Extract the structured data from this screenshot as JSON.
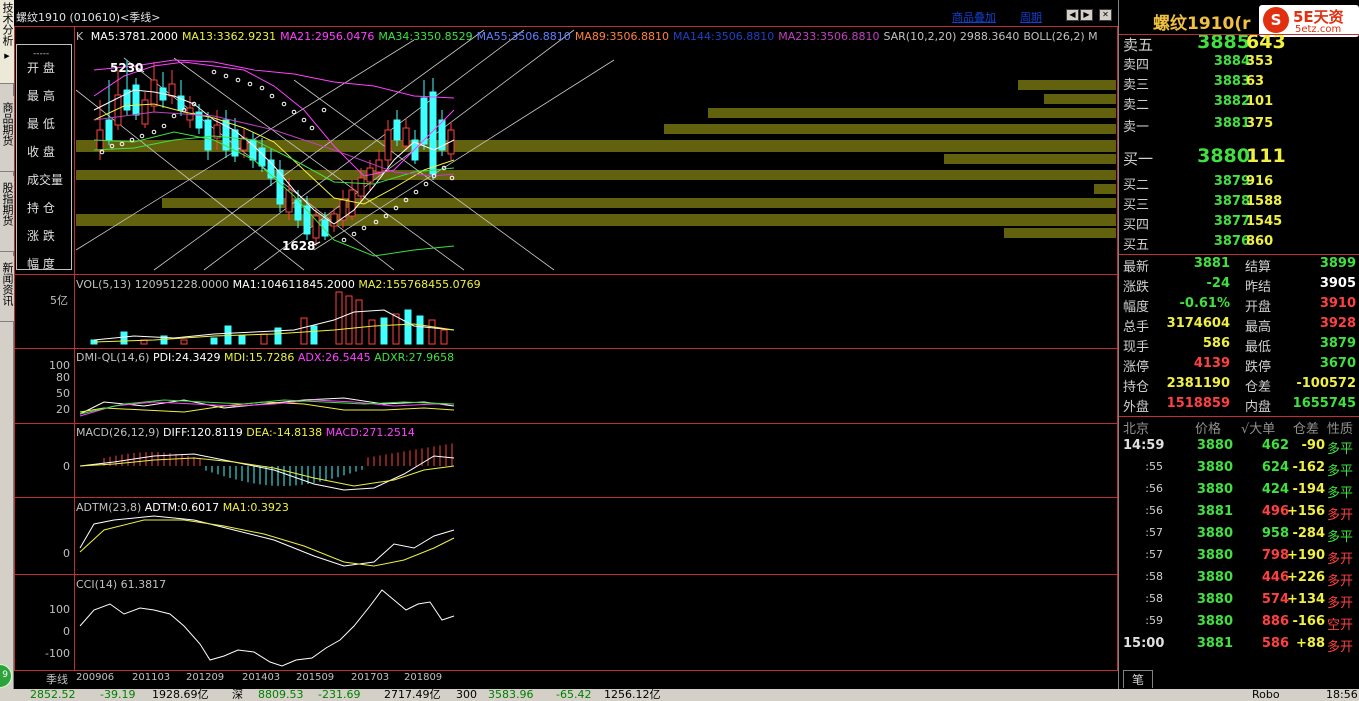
{
  "left_tabs": [
    {
      "label": "技术分析",
      "active": true
    },
    {
      "label": "商品期货",
      "active": false
    },
    {
      "label": "股指期货",
      "active": false
    },
    {
      "label": "新闻资讯",
      "active": false
    }
  ],
  "chart_header": {
    "title": "螺纹1910 (010610)<季线>",
    "links": {
      "overlay": "商品叠加",
      "period": "周期"
    }
  },
  "ohlc_legend": [
    "开 盘",
    "最 高",
    "最 低",
    "收 盘",
    "成交量",
    "持 仓",
    "涨 跌",
    "幅 度"
  ],
  "ohlc_legend_divider": "-----",
  "indicators": {
    "k": {
      "prefix": "K",
      "ma": [
        {
          "text": "MA5:3781.2000",
          "color": "#ffffff"
        },
        {
          "text": "MA13:3362.9231",
          "color": "#f0f040"
        },
        {
          "text": "MA21:2956.0476",
          "color": "#ff40ff"
        },
        {
          "text": "MA34:3350.8529",
          "color": "#40e040"
        },
        {
          "text": "MA55:3506.8810",
          "color": "#6080ff"
        },
        {
          "text": "MA89:3506.8810",
          "color": "#ff8040"
        },
        {
          "text": "MA144:3506.8810",
          "color": "#2040c0"
        },
        {
          "text": "MA233:3506.8810",
          "color": "#c040c0"
        },
        {
          "text": "SAR(10,2,20) 2988.3640",
          "color": "#c0c0c0"
        },
        {
          "text": "BOLL(26,2) M",
          "color": "#c0c0c0"
        }
      ],
      "high_label": "5230",
      "low_label": "1628"
    },
    "vol": {
      "title": "VOL(5,13) 120951228.0000",
      "ma1": "MA1:104611845.2000",
      "ma2": "MA2:155768455.0769",
      "axis": "5亿"
    },
    "dmi": {
      "title": "DMI-QL(14,6)",
      "pdi": "PDI:24.3429",
      "mdi": "MDI:15.7286",
      "adx": "ADX:26.5445",
      "adxr": "ADXR:27.9658",
      "axis": [
        "100",
        "80",
        "50",
        "20"
      ]
    },
    "macd": {
      "title": "MACD(26,12,9)",
      "diff": "DIFF:120.8119",
      "dea": "DEA:-14.8138",
      "macd": "MACD:271.2514",
      "axis": [
        "0"
      ]
    },
    "adtm": {
      "title": "ADTM(23,8)",
      "adtm": "ADTM:0.6017",
      "ma1": "MA1:0.3923",
      "axis": [
        "0"
      ]
    },
    "cci": {
      "title": "CCI(14) 61.3817",
      "axis": [
        "100",
        "0",
        "-100"
      ]
    }
  },
  "x_axis": {
    "period_label": "季线",
    "dates": [
      "200906",
      "201103",
      "201209",
      "201403",
      "201509",
      "201703",
      "201809"
    ]
  },
  "quote": {
    "title": "螺纹1910",
    "title_suffix": "(r",
    "logo_text": "5E天资",
    "logo_url": "5etz.com",
    "logo_mark": "S",
    "asks": [
      {
        "label": "卖五",
        "price": "3885",
        "vol": "643"
      },
      {
        "label": "卖四",
        "price": "3884",
        "vol": "353"
      },
      {
        "label": "卖三",
        "price": "3883",
        "vol": "63"
      },
      {
        "label": "卖二",
        "price": "3882",
        "vol": "101"
      },
      {
        "label": "卖一",
        "price": "3881",
        "vol": "375"
      }
    ],
    "bids": [
      {
        "label": "买一",
        "price": "3880",
        "vol": "111"
      },
      {
        "label": "买二",
        "price": "3879",
        "vol": "916"
      },
      {
        "label": "买三",
        "price": "3878",
        "vol": "1588"
      },
      {
        "label": "买四",
        "price": "3877",
        "vol": "1545"
      },
      {
        "label": "买五",
        "price": "3876",
        "vol": "860"
      }
    ],
    "stats": [
      {
        "l1": "最新",
        "v1": "3881",
        "c1": "#40e040",
        "l2": "结算",
        "v2": "3899",
        "c2": "#40e040"
      },
      {
        "l1": "涨跌",
        "v1": "-24",
        "c1": "#40e040",
        "l2": "昨结",
        "v2": "3905",
        "c2": "#ffffff"
      },
      {
        "l1": "幅度",
        "v1": "-0.61%",
        "c1": "#40e040",
        "l2": "开盘",
        "v2": "3910",
        "c2": "#ff4040"
      },
      {
        "l1": "总手",
        "v1": "3174604",
        "c1": "#f0f040",
        "l2": "最高",
        "v2": "3928",
        "c2": "#ff4040"
      },
      {
        "l1": "现手",
        "v1": "586",
        "c1": "#f0f040",
        "l2": "最低",
        "v2": "3879",
        "c2": "#40e040"
      },
      {
        "l1": "涨停",
        "v1": "4139",
        "c1": "#ff4040",
        "l2": "跌停",
        "v2": "3670",
        "c2": "#40e040"
      },
      {
        "l1": "持仓",
        "v1": "2381190",
        "c1": "#f0f040",
        "l2": "仓差",
        "v2": "-100572",
        "c2": "#f0f040"
      },
      {
        "l1": "外盘",
        "v1": "1518859",
        "c1": "#ff4040",
        "l2": "内盘",
        "v2": "1655745",
        "c2": "#40e040"
      }
    ],
    "ticks_header": {
      "c0": "北京",
      "c1": "价格",
      "c2": "√大单",
      "c3": "仓差",
      "c4": "性质"
    },
    "ticks": [
      {
        "time": "14:59",
        "price": "3880",
        "vol": "462",
        "vol_color": "#40e040",
        "chg": "-90",
        "chg_color": "#f0f040",
        "type": "多平",
        "type_color": "#40e040"
      },
      {
        "time": ":55",
        "price": "3880",
        "vol": "624",
        "vol_color": "#40e040",
        "chg": "-162",
        "chg_color": "#f0f040",
        "type": "多平",
        "type_color": "#40e040"
      },
      {
        "time": ":56",
        "price": "3880",
        "vol": "424",
        "vol_color": "#40e040",
        "chg": "-194",
        "chg_color": "#f0f040",
        "type": "多平",
        "type_color": "#40e040"
      },
      {
        "time": ":56",
        "price": "3881",
        "vol": "496",
        "vol_color": "#ff4040",
        "chg": "+156",
        "chg_color": "#f0f040",
        "type": "多开",
        "type_color": "#ff4040"
      },
      {
        "time": ":57",
        "price": "3880",
        "vol": "958",
        "vol_color": "#40e040",
        "chg": "-284",
        "chg_color": "#f0f040",
        "type": "多平",
        "type_color": "#40e040"
      },
      {
        "time": ":57",
        "price": "3880",
        "vol": "798",
        "vol_color": "#ff4040",
        "chg": "+190",
        "chg_color": "#f0f040",
        "type": "多开",
        "type_color": "#ff4040"
      },
      {
        "time": ":58",
        "price": "3880",
        "vol": "446",
        "vol_color": "#ff4040",
        "chg": "+226",
        "chg_color": "#f0f040",
        "type": "多开",
        "type_color": "#ff4040"
      },
      {
        "time": ":58",
        "price": "3880",
        "vol": "574",
        "vol_color": "#ff4040",
        "chg": "+134",
        "chg_color": "#f0f040",
        "type": "多开",
        "type_color": "#ff4040"
      },
      {
        "time": ":59",
        "price": "3880",
        "vol": "886",
        "vol_color": "#ff4040",
        "chg": "-166",
        "chg_color": "#f0f040",
        "type": "空开",
        "type_color": "#ff4040"
      },
      {
        "time": "15:00",
        "price": "3881",
        "vol": "586",
        "vol_color": "#ff4040",
        "chg": "+88",
        "chg_color": "#f0f040",
        "type": "多开",
        "type_color": "#ff4040"
      }
    ],
    "bottom_tab": "笔"
  },
  "status_bar": [
    {
      "text": "2852.52",
      "color": "#008000"
    },
    {
      "text": "-39.19",
      "color": "#008000"
    },
    {
      "text": "1928.69亿",
      "color": "#000000"
    },
    {
      "text": "深",
      "color": "#000000"
    },
    {
      "text": "8809.53",
      "color": "#008000"
    },
    {
      "text": "-231.69",
      "color": "#008000"
    },
    {
      "text": "2717.49亿",
      "color": "#000000"
    },
    {
      "text": "300",
      "color": "#000000"
    },
    {
      "text": "3583.96",
      "color": "#008000"
    },
    {
      "text": "-65.42",
      "color": "#008000"
    },
    {
      "text": "1256.12亿",
      "color": "#000000"
    },
    {
      "text": "Robo",
      "color": "#000000"
    },
    {
      "text": "18:56",
      "color": "#000000"
    }
  ],
  "chart_data": {
    "type": "candlestick",
    "title": "螺纹1910 (010610)<季线>",
    "x_dates": [
      "200906",
      "201103",
      "201209",
      "201403",
      "201509",
      "201703",
      "201809"
    ],
    "price_range": [
      1628,
      5230
    ],
    "annotated_high": 5230,
    "annotated_low": 1628,
    "last_close": 3881,
    "grid": false,
    "colors": {
      "up": "#ff4040",
      "down": "#40ffff",
      "background": "#000000"
    }
  }
}
